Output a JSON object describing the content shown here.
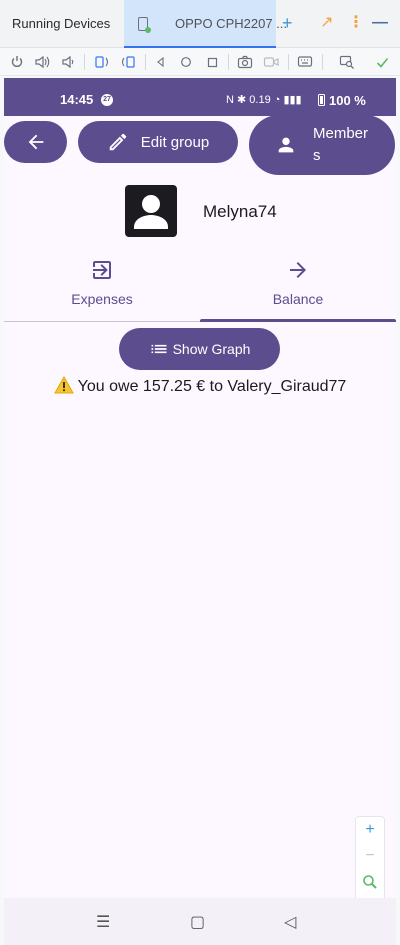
{
  "ide": {
    "window_title": "Running Devices",
    "device_tab": "OPPO CPH2207 ...",
    "add_label": "+",
    "arrow_label": "↗",
    "dots_label": "⋮",
    "minimize_label": "—",
    "toolbar_icons": [
      "power-icon",
      "volume-up-icon",
      "volume-down-icon",
      "rotate-left-icon",
      "rotate-right-icon",
      "back-icon",
      "home-icon",
      "overview-icon",
      "camera-icon",
      "record-icon",
      "keyboard-icon",
      "screen-search-icon",
      "check-icon"
    ]
  },
  "status_bar": {
    "time": "14:45",
    "notification_badge": "27",
    "icons_text": "N ✱ 0.19 ◔ ▮▮▮",
    "battery_pct": "100 %"
  },
  "app": {
    "edit_group_label": "Edit group",
    "members_label": "Members",
    "username": "Melyna74",
    "tabs": [
      {
        "label": "Expenses",
        "icon": "login-icon",
        "selected": false
      },
      {
        "label": "Balance",
        "icon": "arrow-right-icon",
        "selected": true
      }
    ],
    "show_graph_label": "Show Graph",
    "owe_message": "You owe 157.25 € to Valery_Giraud77"
  },
  "zoom": {
    "plus": "+",
    "minus": "−"
  },
  "nav": {
    "menu_icon": "☰",
    "home_icon": "▢",
    "back_icon": "◁"
  },
  "colors": {
    "primary": "#5c4d8f",
    "background": "#fdf7ff",
    "ide_tab_active": "#d3e5fb"
  }
}
